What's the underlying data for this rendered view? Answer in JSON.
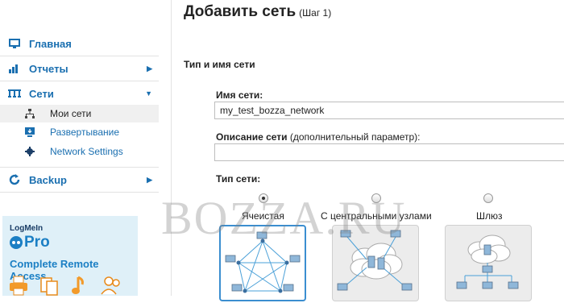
{
  "page": {
    "title": "Добавить сеть",
    "step": "(Шаг 1)"
  },
  "sidebar": {
    "items": [
      {
        "label": "Главная",
        "icon": "monitor-icon"
      },
      {
        "label": "Отчеты",
        "icon": "bar-chart-icon"
      },
      {
        "label": "Сети",
        "icon": "network-icon"
      },
      {
        "label": "Backup",
        "icon": "refresh-icon"
      }
    ],
    "subitems": [
      {
        "label": "Мои сети",
        "icon": "network-tree-icon"
      },
      {
        "label": "Развертывание",
        "icon": "deploy-icon"
      },
      {
        "label": "Network Settings",
        "icon": "gear-icon"
      }
    ]
  },
  "ad": {
    "brand": "LogMeIn",
    "product": "Pro",
    "tagline": "Complete Remote Access"
  },
  "form": {
    "section_title": "Тип и имя сети",
    "name_label": "Имя сети:",
    "name_value": "my_test_bozza_network",
    "desc_label": "Описание сети",
    "desc_hint": "(дополнительный параметр):",
    "desc_value": "",
    "type_label": "Тип сети:",
    "types": [
      {
        "label": "Ячеистая",
        "checked": true
      },
      {
        "label": "С центральными узлами",
        "checked": false
      },
      {
        "label": "Шлюз",
        "checked": false
      }
    ]
  },
  "watermark": "BOZZA.RU",
  "colors": {
    "link": "#1a6fb0",
    "accent": "#3b8ed0",
    "ad_bg": "#dff0f8"
  }
}
